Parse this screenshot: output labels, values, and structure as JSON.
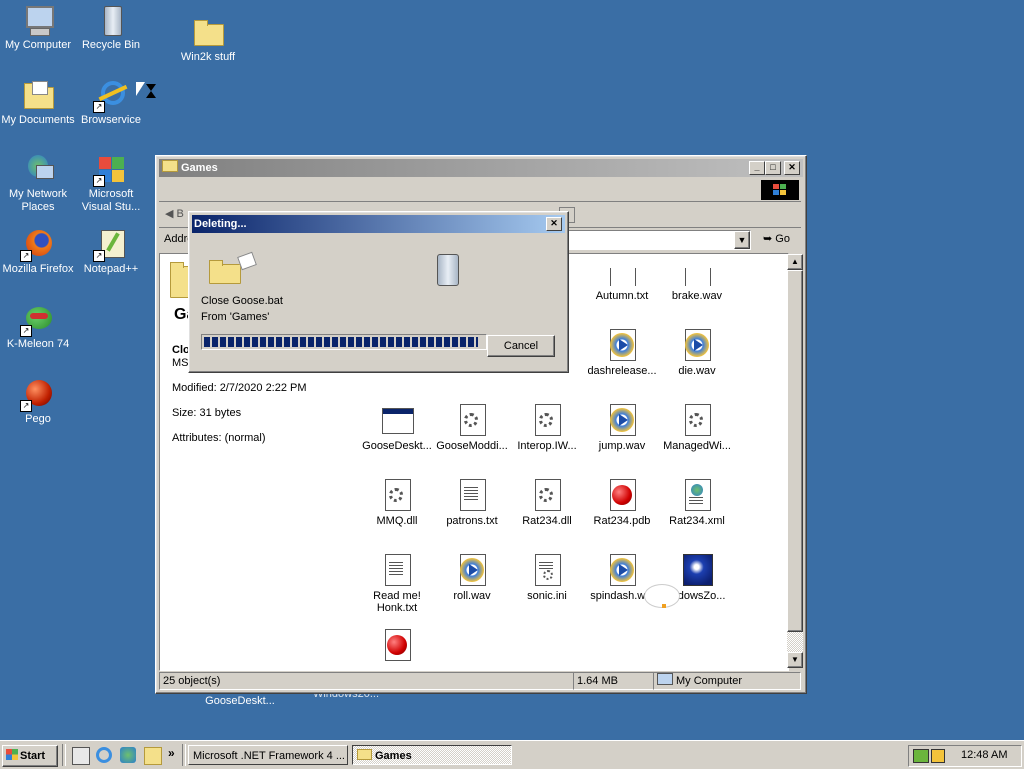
{
  "desktop": {
    "icons": [
      {
        "label": "My Computer",
        "icon": "my-computer-icon"
      },
      {
        "label": "Recycle Bin",
        "icon": "recycle-bin-icon"
      },
      {
        "label": "Win2k stuff",
        "icon": "folder-icon"
      },
      {
        "label": "My Documents",
        "icon": "my-documents-icon"
      },
      {
        "label": "Browservice",
        "icon": "internet-explorer-icon"
      },
      {
        "label": "My Network Places",
        "icon": "network-places-icon"
      },
      {
        "label": "Microsoft Visual Stu...",
        "icon": "visual-studio-icon"
      },
      {
        "label": "Mozilla Firefox",
        "icon": "firefox-icon"
      },
      {
        "label": "Notepad++",
        "icon": "notepadpp-icon"
      },
      {
        "label": "K-Meleon 74",
        "icon": "kmeleon-icon"
      },
      {
        "label": "Pego",
        "icon": "pego-icon"
      },
      {
        "label": "GooseDeskt...",
        "icon": "goose-desktop-icon"
      },
      {
        "label": "Windows20...",
        "icon": "windows-file-icon"
      }
    ]
  },
  "explorer": {
    "title": "Games",
    "address_label": "Addre",
    "go_label": "Go",
    "back_label": "B",
    "panel": {
      "heading_partial": "Ga",
      "file_name_partial": "Clo",
      "file_type_partial": "MS-",
      "modified": "Modified: 2/7/2020 2:22 PM",
      "size": "Size: 31 bytes",
      "attributes": "Attributes: (normal)"
    },
    "files": [
      {
        "label": "Autumn.txt",
        "icon": "text-file-icon"
      },
      {
        "label": "brake.wav",
        "icon": "wav-file-icon"
      },
      {
        "label": "dashrelease...",
        "icon": "wav-file-icon"
      },
      {
        "label": "die.wav",
        "icon": "wav-file-icon"
      },
      {
        "label": "GooseDeskt...",
        "icon": "application-icon"
      },
      {
        "label": "GooseModdi...",
        "icon": "dll-file-icon"
      },
      {
        "label": "Interop.IW...",
        "icon": "dll-file-icon"
      },
      {
        "label": "jump.wav",
        "icon": "wav-file-icon"
      },
      {
        "label": "ManagedWi...",
        "icon": "dll-file-icon"
      },
      {
        "label": "MMQ.dll",
        "icon": "dll-file-icon"
      },
      {
        "label": "patrons.txt",
        "icon": "text-file-icon"
      },
      {
        "label": "Rat234.dll",
        "icon": "dll-file-icon"
      },
      {
        "label": "Rat234.pdb",
        "icon": "pdb-file-icon"
      },
      {
        "label": "Rat234.xml",
        "icon": "xml-file-icon"
      },
      {
        "label": "Read me! Honk.txt",
        "icon": "text-file-icon"
      },
      {
        "label": "roll.wav",
        "icon": "wav-file-icon"
      },
      {
        "label": "sonic.ini",
        "icon": "ini-file-icon"
      },
      {
        "label": "spindash.w...",
        "icon": "wav-file-icon"
      },
      {
        "label": "...dowsZo...",
        "icon": "sonic-image-icon"
      }
    ],
    "status": {
      "objects": "25 object(s)",
      "size": "1.64 MB",
      "zone": "My Computer"
    }
  },
  "dialog": {
    "title": "Deleting...",
    "line1": "Close Goose.bat",
    "line2": "From 'Games'",
    "cancel_label": "Cancel",
    "progress": 0.98
  },
  "taskbar": {
    "start_label": "Start",
    "tasks": [
      {
        "label": "Microsoft .NET Framework 4 ..."
      },
      {
        "label": "Games"
      }
    ],
    "clock": "12:48 AM"
  },
  "colors": {
    "desktop": "#3a6ea5",
    "active_title": "#0a246a",
    "inactive_title": "#808080",
    "progress_block": "#0a246a"
  }
}
